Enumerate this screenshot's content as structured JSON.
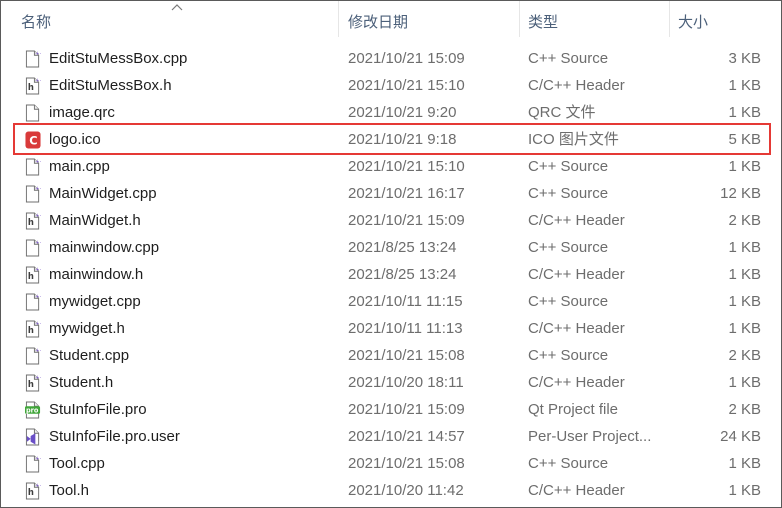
{
  "columns": {
    "name": "名称",
    "date": "修改日期",
    "type": "类型",
    "size": "大小"
  },
  "colors": {
    "header_text": "#4c607a",
    "highlight_border": "#e53935",
    "ico_badge": "#d93a3a",
    "pro_badge": "#41a63a",
    "user_badge": "#6a4fc7"
  },
  "files": [
    {
      "name": "EditStuMessBox.cpp",
      "date": "2021/10/21 15:09",
      "type": "C++ Source",
      "size": "3 KB",
      "icon": "cpp-file-icon"
    },
    {
      "name": "EditStuMessBox.h",
      "date": "2021/10/21 15:10",
      "type": "C/C++ Header",
      "size": "1 KB",
      "icon": "header-file-icon"
    },
    {
      "name": "image.qrc",
      "date": "2021/10/21 9:20",
      "type": "QRC 文件",
      "size": "1 KB",
      "icon": "blank-file-icon"
    },
    {
      "name": "logo.ico",
      "date": "2021/10/21 9:18",
      "type": "ICO 图片文件",
      "size": "5 KB",
      "icon": "ico-file-icon"
    },
    {
      "name": "main.cpp",
      "date": "2021/10/21 15:10",
      "type": "C++ Source",
      "size": "1 KB",
      "icon": "cpp-file-icon"
    },
    {
      "name": "MainWidget.cpp",
      "date": "2021/10/21 16:17",
      "type": "C++ Source",
      "size": "12 KB",
      "icon": "cpp-file-icon"
    },
    {
      "name": "MainWidget.h",
      "date": "2021/10/21 15:09",
      "type": "C/C++ Header",
      "size": "2 KB",
      "icon": "header-file-icon"
    },
    {
      "name": "mainwindow.cpp",
      "date": "2021/8/25 13:24",
      "type": "C++ Source",
      "size": "1 KB",
      "icon": "cpp-file-icon"
    },
    {
      "name": "mainwindow.h",
      "date": "2021/8/25 13:24",
      "type": "C/C++ Header",
      "size": "1 KB",
      "icon": "header-file-icon"
    },
    {
      "name": "mywidget.cpp",
      "date": "2021/10/11 11:15",
      "type": "C++ Source",
      "size": "1 KB",
      "icon": "cpp-file-icon"
    },
    {
      "name": "mywidget.h",
      "date": "2021/10/11 11:13",
      "type": "C/C++ Header",
      "size": "1 KB",
      "icon": "header-file-icon"
    },
    {
      "name": "Student.cpp",
      "date": "2021/10/21 15:08",
      "type": "C++ Source",
      "size": "2 KB",
      "icon": "cpp-file-icon"
    },
    {
      "name": "Student.h",
      "date": "2021/10/20 18:11",
      "type": "C/C++ Header",
      "size": "1 KB",
      "icon": "header-file-icon"
    },
    {
      "name": "StuInfoFile.pro",
      "date": "2021/10/21 15:09",
      "type": "Qt Project file",
      "size": "2 KB",
      "icon": "qt-pro-file-icon"
    },
    {
      "name": "StuInfoFile.pro.user",
      "date": "2021/10/21 14:57",
      "type": "Per-User Project...",
      "size": "24 KB",
      "icon": "pro-user-file-icon"
    },
    {
      "name": "Tool.cpp",
      "date": "2021/10/21 15:08",
      "type": "C++ Source",
      "size": "1 KB",
      "icon": "cpp-file-icon"
    },
    {
      "name": "Tool.h",
      "date": "2021/10/20 11:42",
      "type": "C/C++ Header",
      "size": "1 KB",
      "icon": "header-file-icon"
    }
  ]
}
